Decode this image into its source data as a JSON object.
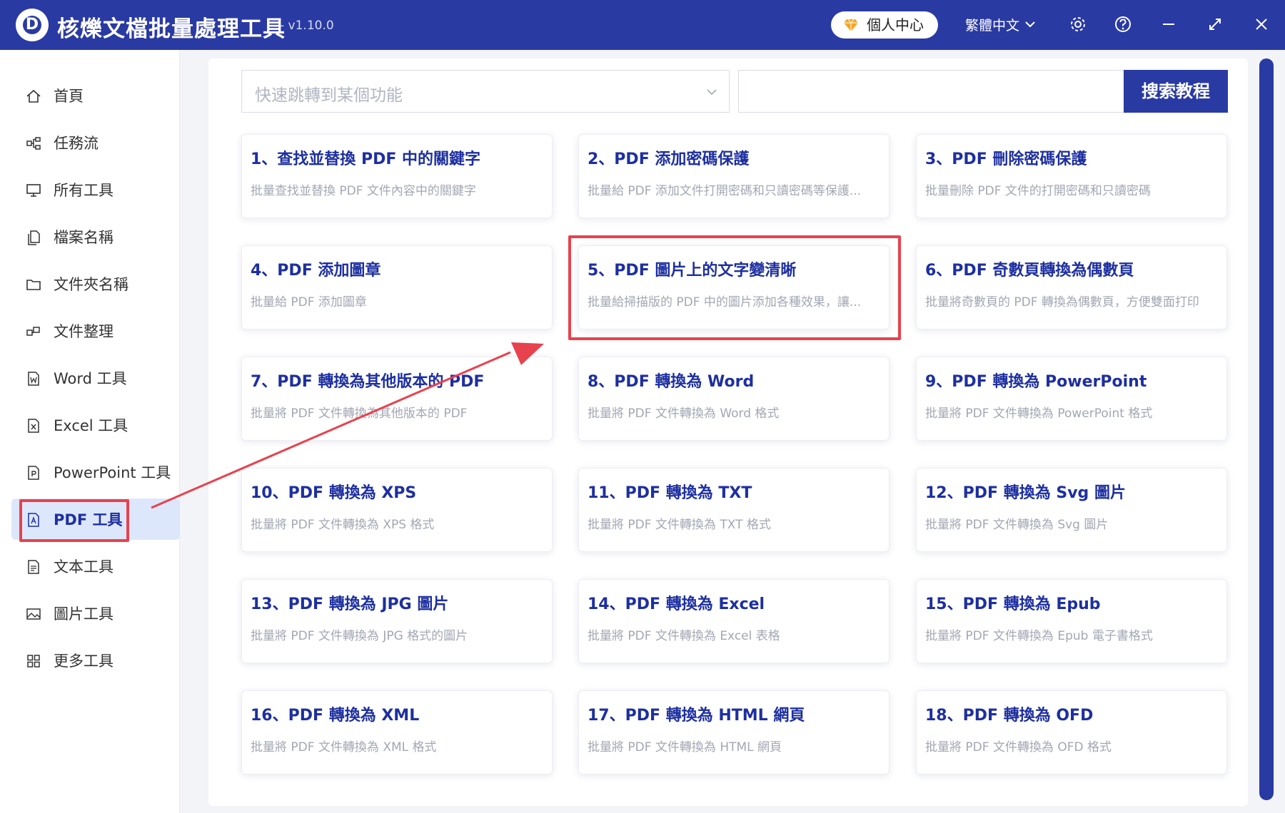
{
  "titlebar": {
    "logo_letter": "D",
    "title": "核爍文檔批量處理工具",
    "version": "- v1.10.0",
    "vip_label": "個人中心",
    "language": "繁體中文"
  },
  "sidebar": {
    "items": [
      {
        "label": "首頁",
        "icon": "home-icon"
      },
      {
        "label": "任務流",
        "icon": "workflow-icon"
      },
      {
        "label": "所有工具",
        "icon": "monitor-icon"
      },
      {
        "label": "檔案名稱",
        "icon": "file-copy-icon"
      },
      {
        "label": "文件夾名稱",
        "icon": "folder-icon"
      },
      {
        "label": "文件整理",
        "icon": "organize-icon"
      },
      {
        "label": "Word 工具",
        "icon": "word-file-icon"
      },
      {
        "label": "Excel 工具",
        "icon": "excel-file-icon"
      },
      {
        "label": "PowerPoint 工具",
        "icon": "ppt-file-icon"
      },
      {
        "label": "PDF 工具",
        "icon": "pdf-file-icon",
        "active": true
      },
      {
        "label": "文本工具",
        "icon": "text-file-icon"
      },
      {
        "label": "圖片工具",
        "icon": "image-icon"
      },
      {
        "label": "更多工具",
        "icon": "grid-icon"
      }
    ]
  },
  "search": {
    "jump_placeholder": "快速跳轉到某個功能",
    "search_value": "",
    "search_button": "搜索教程"
  },
  "cards": [
    {
      "title": "1、查找並替換 PDF 中的關鍵字",
      "desc": "批量查找並替換 PDF 文件內容中的關鍵字"
    },
    {
      "title": "2、PDF 添加密碼保護",
      "desc": "批量給 PDF 添加文件打開密碼和只讀密碼等保護..."
    },
    {
      "title": "3、PDF 刪除密碼保護",
      "desc": "批量刪除 PDF 文件的打開密碼和只讀密碼"
    },
    {
      "title": "4、PDF 添加圖章",
      "desc": "批量給 PDF 添加圖章"
    },
    {
      "title": "5、PDF 圖片上的文字變清晰",
      "desc": "批量給掃描版的 PDF 中的圖片添加各種效果，讓..."
    },
    {
      "title": "6、PDF 奇數頁轉換為偶數頁",
      "desc": "批量將奇數頁的 PDF 轉換為偶數頁，方便雙面打印"
    },
    {
      "title": "7、PDF 轉換為其他版本的 PDF",
      "desc": "批量將 PDF 文件轉換為其他版本的 PDF"
    },
    {
      "title": "8、PDF 轉換為 Word",
      "desc": "批量將 PDF 文件轉換為 Word 格式"
    },
    {
      "title": "9、PDF 轉換為 PowerPoint",
      "desc": "批量將 PDF 文件轉換為 PowerPoint 格式"
    },
    {
      "title": "10、PDF 轉換為 XPS",
      "desc": "批量將 PDF 文件轉換為 XPS 格式"
    },
    {
      "title": "11、PDF 轉換為 TXT",
      "desc": "批量將 PDF 文件轉換為 TXT 格式"
    },
    {
      "title": "12、PDF 轉換為 Svg 圖片",
      "desc": "批量將 PDF 文件轉換為 Svg 圖片"
    },
    {
      "title": "13、PDF 轉換為 JPG 圖片",
      "desc": "批量將 PDF 文件轉換為 JPG 格式的圖片"
    },
    {
      "title": "14、PDF 轉換為 Excel",
      "desc": "批量將 PDF 文件轉換為 Excel 表格"
    },
    {
      "title": "15、PDF 轉換為 Epub",
      "desc": "批量將 PDF 文件轉換為 Epub 電子書格式"
    },
    {
      "title": "16、PDF 轉換為 XML",
      "desc": "批量將 PDF 文件轉換為 XML 格式"
    },
    {
      "title": "17、PDF 轉換為 HTML 網頁",
      "desc": "批量將 PDF 文件轉換為 HTML 網頁"
    },
    {
      "title": "18、PDF 轉換為 OFD",
      "desc": "批量將 PDF 文件轉換為 OFD 格式"
    }
  ],
  "colors": {
    "brand": "#2a3aa3",
    "card_title": "#1d2fa0",
    "highlight": "#e8424e",
    "active_nav_bg": "#dde7fb"
  }
}
